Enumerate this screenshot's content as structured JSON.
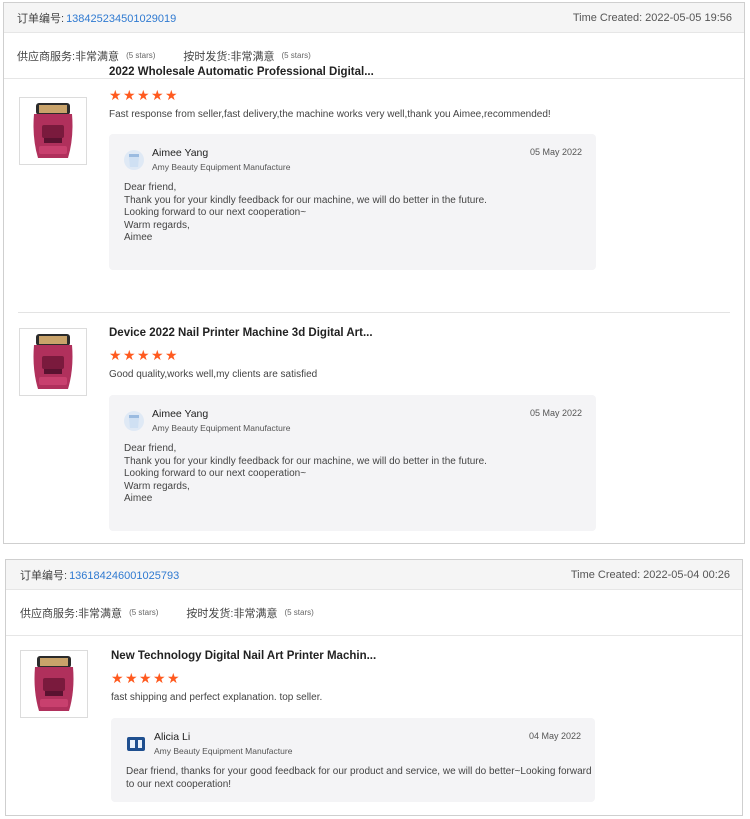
{
  "orders": [
    {
      "order_no_label": "订单编号:",
      "order_no": "138425234501029019",
      "time_label": "Time Created:",
      "time": "2022-05-05 19:56",
      "services": [
        {
          "label": "供应商服务:",
          "rating": "非常满意",
          "stars_note": "(5 stars)"
        },
        {
          "label": "按时发货:",
          "rating": "非常满意",
          "stars_note": "(5 stars)"
        }
      ],
      "items": [
        {
          "title": "2022 Wholesale Automatic Professional Digital...",
          "stars": 5,
          "comment": "Fast response from seller,fast delivery,the machine works very well,thank you Aimee,recommended!",
          "reply": {
            "name": "Aimee Yang",
            "company": "Amy Beauty Equipment Manufacture",
            "date": "05 May 2022",
            "lines": [
              "Dear friend,",
              "Thank you for your kindly feedback for our machine, we will do better in the future.",
              "Looking forward to our next cooperation~",
              "Warm regards,",
              "Aimee"
            ]
          }
        },
        {
          "title": "Device 2022 Nail Printer Machine 3d Digital Art...",
          "stars": 5,
          "comment": "Good quality,works well,my clients are satisfied",
          "reply": {
            "name": "Aimee Yang",
            "company": "Amy Beauty Equipment Manufacture",
            "date": "05 May 2022",
            "lines": [
              "Dear friend,",
              "Thank you for your kindly feedback for our machine, we will do better in the future.",
              "Looking forward to our next cooperation~",
              "Warm regards,",
              "Aimee"
            ]
          }
        }
      ]
    },
    {
      "order_no_label": "订单编号:",
      "order_no": "136184246001025793",
      "time_label": "Time Created:",
      "time": "2022-05-04 00:26",
      "services": [
        {
          "label": "供应商服务:",
          "rating": "非常满意",
          "stars_note": "(5 stars)"
        },
        {
          "label": "按时发货:",
          "rating": "非常满意",
          "stars_note": "(5 stars)"
        }
      ],
      "items": [
        {
          "title": "New Technology Digital Nail Art Printer Machin...",
          "stars": 5,
          "comment": "fast shipping and perfect explanation. top seller.",
          "reply": {
            "name": "Alicia Li",
            "company": "Amy Beauty Equipment Manufacture",
            "date": "04 May 2022",
            "lines": [
              "Dear friend, thanks for your good feedback for our product and service, we will do better~Looking forward",
              "to our next cooperation!"
            ]
          }
        }
      ]
    }
  ],
  "icons": {
    "star": "star-icon",
    "avatar": "avatar-icon",
    "product": "nail-printer-thumbnail"
  },
  "colors": {
    "star": "#ff5a1f",
    "link": "#2f7ad1",
    "product": "#b0305c"
  }
}
